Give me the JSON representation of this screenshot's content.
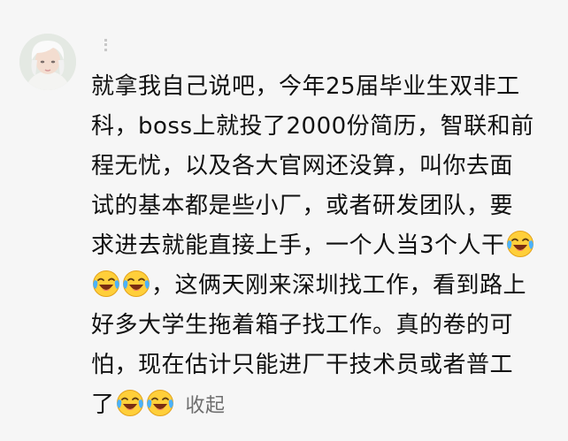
{
  "comment": {
    "lines": [
      "就拿我自己说吧，今年25届毕业生双非工",
      "科，boss上就投了2000份简历，智联和前",
      "程无忧，以及各大官网还没算，叫你去面",
      "试的基本都是些小厂，或者研发团队，要",
      "求进去就能直接上手，一个人当3个人干",
      "，这俩天刚来深圳找工作，看到路上",
      "好多大学生拖着箱子找工作。真的卷的可",
      "怕，现在估计只能进厂干技术员或者普工",
      "了"
    ],
    "emoji": "laughing-crying-emoji",
    "collapse_label": "收起"
  }
}
